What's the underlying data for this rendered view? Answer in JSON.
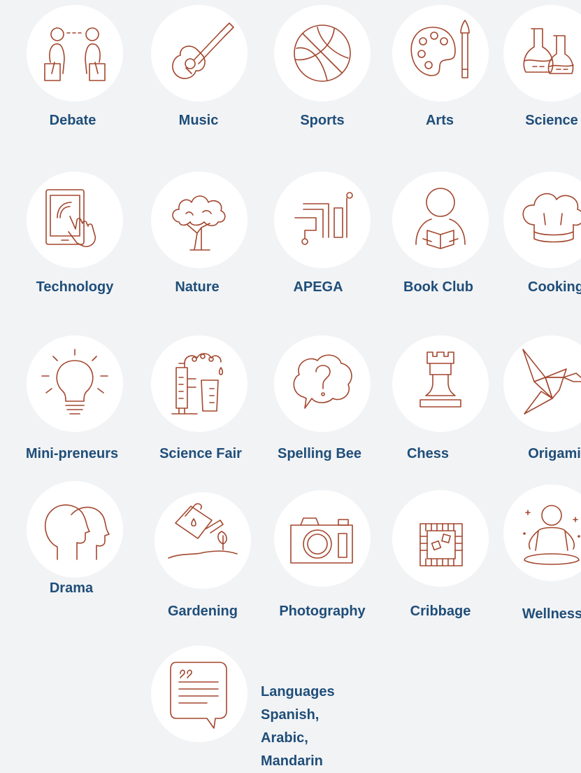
{
  "colors": {
    "background": "#f2f3f5",
    "circle": "#ffffff",
    "icon_stroke": "#a3472e",
    "label": "#1f4e79"
  },
  "activities": [
    {
      "label": "Debate",
      "icon": "debate-icon"
    },
    {
      "label": "Music",
      "icon": "guitar-icon"
    },
    {
      "label": "Sports",
      "icon": "basketball-icon"
    },
    {
      "label": "Arts",
      "icon": "palette-icon"
    },
    {
      "label": "Science",
      "icon": "flask-icon"
    },
    {
      "label": "Technology",
      "icon": "tablet-touch-icon"
    },
    {
      "label": "Nature",
      "icon": "tree-icon"
    },
    {
      "label": "APEGA",
      "icon": "circuit-icon"
    },
    {
      "label": "Book Club",
      "icon": "reader-icon"
    },
    {
      "label": "Cooking",
      "icon": "chef-hat-icon"
    },
    {
      "label": "Mini-preneurs",
      "icon": "lightbulb-icon"
    },
    {
      "label": "Science Fair",
      "icon": "lab-equipment-icon"
    },
    {
      "label": "Spelling Bee",
      "icon": "question-bubble-icon"
    },
    {
      "label": "Chess",
      "icon": "chess-rook-icon"
    },
    {
      "label": "Origami",
      "icon": "origami-bird-icon"
    },
    {
      "label": "Drama",
      "icon": "heads-icon"
    },
    {
      "label": "Gardening",
      "icon": "watering-can-icon"
    },
    {
      "label": "Photography",
      "icon": "camera-icon"
    },
    {
      "label": "Cribbage",
      "icon": "board-game-icon"
    },
    {
      "label": "Wellness",
      "icon": "meditation-icon"
    }
  ],
  "languages": {
    "icon": "speech-bubble-icon",
    "title": "Languages",
    "list": "Spanish, Arabic, Mandarin"
  }
}
